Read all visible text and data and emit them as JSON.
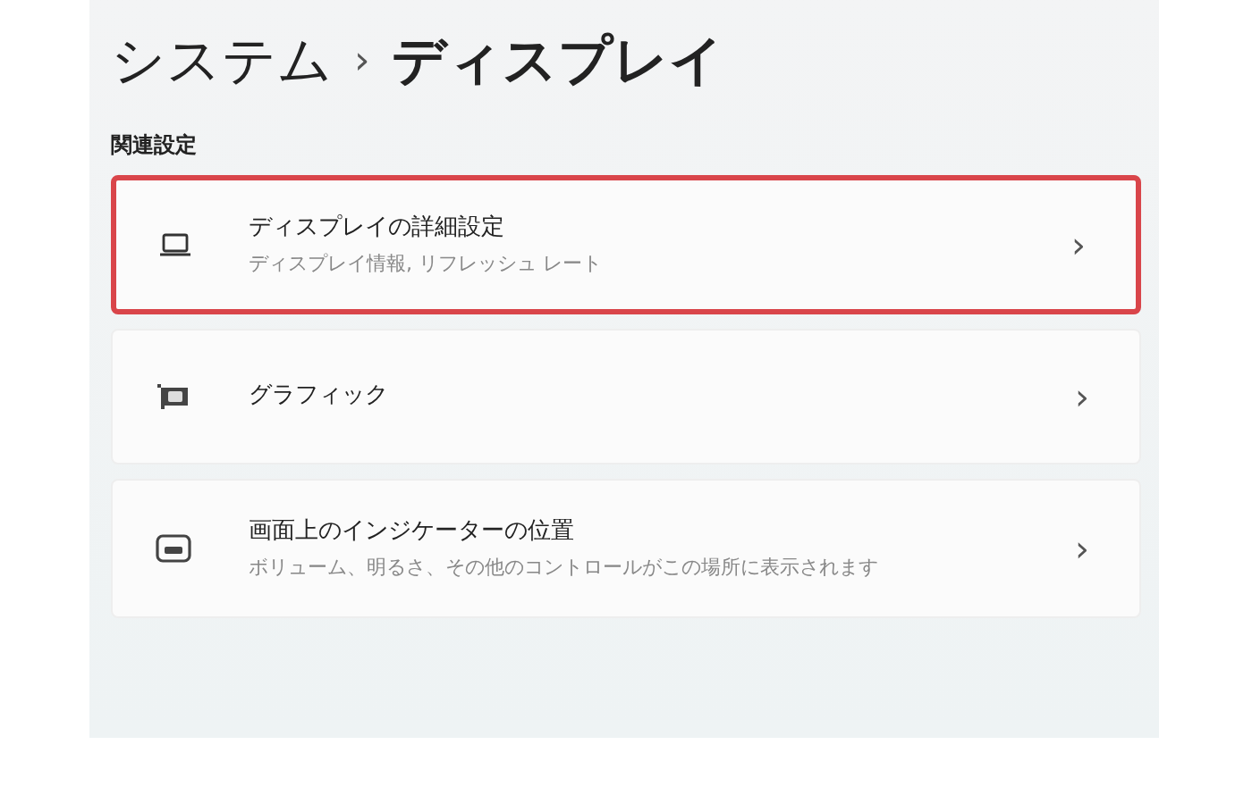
{
  "breadcrumb": {
    "parent": "システム",
    "separator": "›",
    "current": "ディスプレイ"
  },
  "section_title": "関連設定",
  "items": [
    {
      "kind": "laptop",
      "title": "ディスプレイの詳細設定",
      "subtitle": "ディスプレイ情報, リフレッシュ レート",
      "chevron": "›",
      "highlighted": true
    },
    {
      "kind": "graphics",
      "title": "グラフィック",
      "chevron": "›",
      "highlighted": false
    },
    {
      "kind": "indicator",
      "title": "画面上のインジケーターの位置",
      "subtitle": "ボリューム、明るさ、その他のコントロールがこの場所に表示されます",
      "chevron": "›",
      "highlighted": false
    }
  ]
}
